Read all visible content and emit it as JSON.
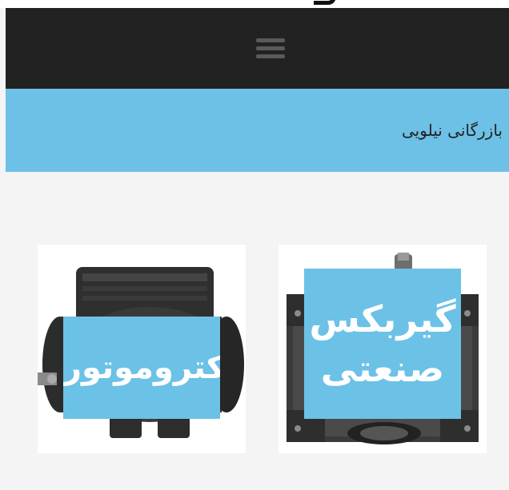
{
  "navbar": {
    "menu_icon": "hamburger-menu-icon"
  },
  "breadcrumb": {
    "title": "بازرگانی نیلویی"
  },
  "products": [
    {
      "label": "گیربکس صنعتی",
      "icon": "gearbox-image"
    },
    {
      "label": "الکتروموتور",
      "icon": "electric-motor-image"
    }
  ],
  "colors": {
    "navbar": "#222222",
    "accent_blue": "#6dc0e6",
    "background": "#f4f4f4"
  }
}
